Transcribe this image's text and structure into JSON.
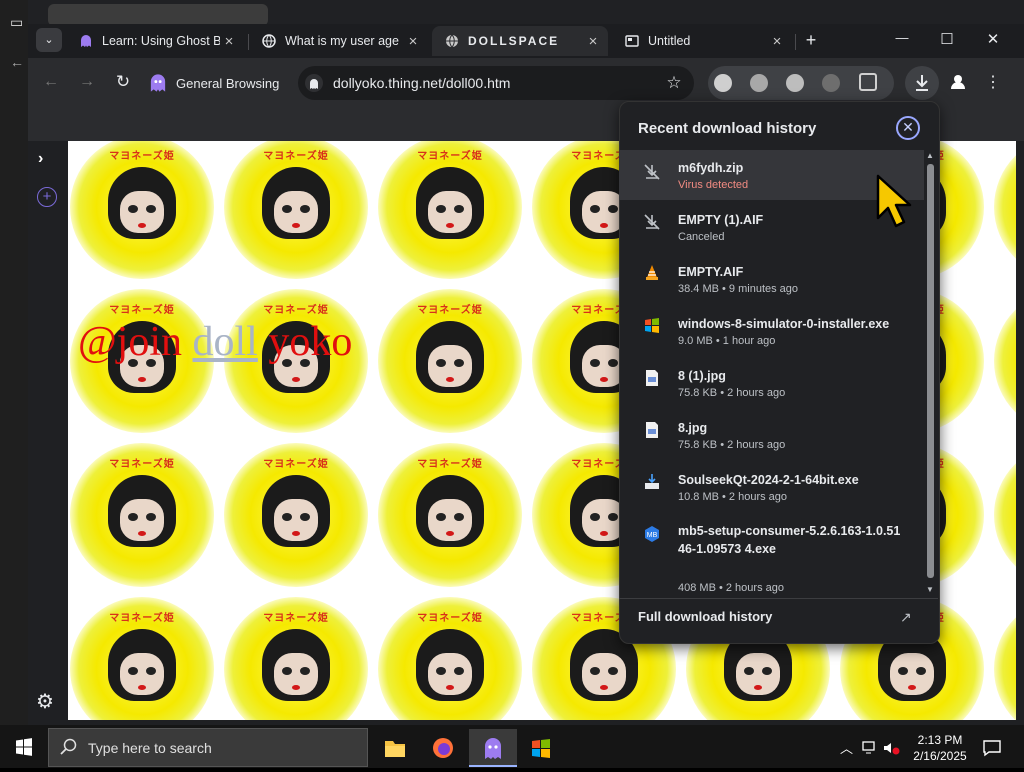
{
  "tabs": [
    {
      "title": "Learn: Using Ghost B",
      "icon": "ghost-icon",
      "close": "×"
    },
    {
      "title": "What is my user age",
      "icon": "globe-icon",
      "close": "×"
    },
    {
      "title": "DOLLSPACE",
      "icon": "globe-icon",
      "close": "×",
      "active": true
    },
    {
      "title": "Untitled",
      "icon": "page-icon",
      "close": "×"
    }
  ],
  "new_tab": "+",
  "window_controls": {
    "minimize": "—",
    "maximize": "☐",
    "close": "✕"
  },
  "toolbar": {
    "session_label": "General Browsing",
    "url": "dollyoko.thing.net/doll00.htm"
  },
  "page": {
    "overlay_text": {
      "part1": "@join ",
      "part2": "doll",
      "part3": " yoko"
    },
    "tile_banner": "マヨネーズ姫"
  },
  "downloads": {
    "title": "Recent download history",
    "items": [
      {
        "name": "m6fydh.zip",
        "sub": "Virus detected",
        "icon": "blocked-icon"
      },
      {
        "name": "EMPTY (1).AIF",
        "sub": "Canceled",
        "icon": "blocked-icon"
      },
      {
        "name": "EMPTY.AIF",
        "sub": "38.4 MB • 9 minutes ago",
        "icon": "vlc-icon"
      },
      {
        "name": "windows-8-simulator-0-installer.exe",
        "sub": "9.0 MB • 1 hour ago",
        "icon": "windows-icon"
      },
      {
        "name": "8 (1).jpg",
        "sub": "75.8 KB • 2 hours ago",
        "icon": "image-file-icon"
      },
      {
        "name": "8.jpg",
        "sub": "75.8 KB • 2 hours ago",
        "icon": "image-file-icon"
      },
      {
        "name": "SoulseekQt-2024-2-1-64bit.exe",
        "sub": "10.8 MB • 2 hours ago",
        "icon": "installer-icon"
      },
      {
        "name": "mb5-setup-consumer-5.2.6.163-1.0.5146-1.09573 4.exe",
        "sub": "408 MB • 2 hours ago",
        "icon": "malwarebytes-icon"
      }
    ],
    "full_history": "Full download history"
  },
  "taskbar": {
    "search_placeholder": "Type here to search",
    "time": "2:13 PM",
    "date": "2/16/2025"
  },
  "colors": {
    "virus": "#f28b82",
    "accent": "#9aa8ff"
  }
}
